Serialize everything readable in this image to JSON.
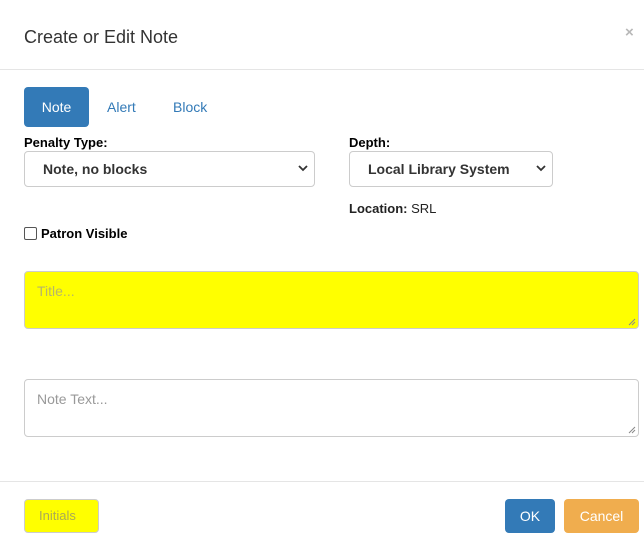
{
  "modal": {
    "title": "Create or Edit Note",
    "close_symbol": "×"
  },
  "tabs": [
    {
      "label": "Note",
      "active": true
    },
    {
      "label": "Alert",
      "active": false
    },
    {
      "label": "Block",
      "active": false
    }
  ],
  "form": {
    "penalty_type_label": "Penalty Type:",
    "penalty_type_value": "Note, no blocks",
    "depth_label": "Depth:",
    "depth_value": "Local Library System",
    "location_label": "Location:",
    "location_value": "SRL",
    "patron_visible_label": "Patron Visible",
    "patron_visible_checked": false,
    "title_placeholder": "Title...",
    "note_text_placeholder": "Note Text..."
  },
  "footer": {
    "initials_placeholder": "Initials",
    "ok_label": "OK",
    "cancel_label": "Cancel"
  },
  "colors": {
    "primary": "#337ab7",
    "warning": "#f0ad4e",
    "highlight": "#ffff00"
  },
  "icons": {
    "close": "close-icon",
    "select_arrow": "chevron-down-icon",
    "resize": "resize-grip-icon"
  }
}
